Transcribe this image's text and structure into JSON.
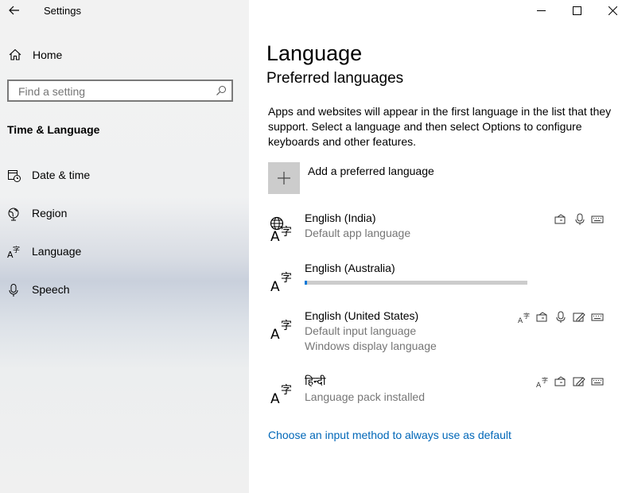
{
  "app": {
    "title": "Settings"
  },
  "sidebar": {
    "home_label": "Home",
    "search_placeholder": "Find a setting",
    "section_title": "Time & Language",
    "items": [
      {
        "label": "Date & time",
        "icon": "date-time-icon"
      },
      {
        "label": "Region",
        "icon": "globe-icon"
      },
      {
        "label": "Language",
        "icon": "language-icon"
      },
      {
        "label": "Speech",
        "icon": "microphone-icon"
      }
    ]
  },
  "main": {
    "title": "Language",
    "subtitle": "Preferred languages",
    "description": "Apps and websites will appear in the first language in the list that they support. Select a language and then select Options to configure keyboards and other features.",
    "add_label": "Add a preferred language",
    "languages": [
      {
        "name": "English (India)",
        "sub1": "Default app language",
        "sub2": "",
        "features": [
          "text-to-speech-icon",
          "speech-recognition-icon",
          "keyboard-icon"
        ]
      },
      {
        "name": "English (Australia)",
        "sub1": "",
        "sub2": "",
        "progress": 0.01,
        "features": []
      },
      {
        "name": "English (United States)",
        "sub1": "Default input language",
        "sub2": "Windows display language",
        "features": [
          "display-language-icon",
          "text-to-speech-icon",
          "speech-recognition-icon",
          "handwriting-icon",
          "keyboard-icon"
        ]
      },
      {
        "name": "हिन्दी",
        "sub1": "Language pack installed",
        "sub2": "",
        "features": [
          "display-language-icon",
          "text-to-speech-icon",
          "handwriting-icon",
          "keyboard-icon"
        ]
      }
    ],
    "link_label": "Choose an input method to always use as default"
  },
  "colors": {
    "accent": "#0078d7",
    "link": "#0067b8",
    "secondary_text": "#767676"
  }
}
